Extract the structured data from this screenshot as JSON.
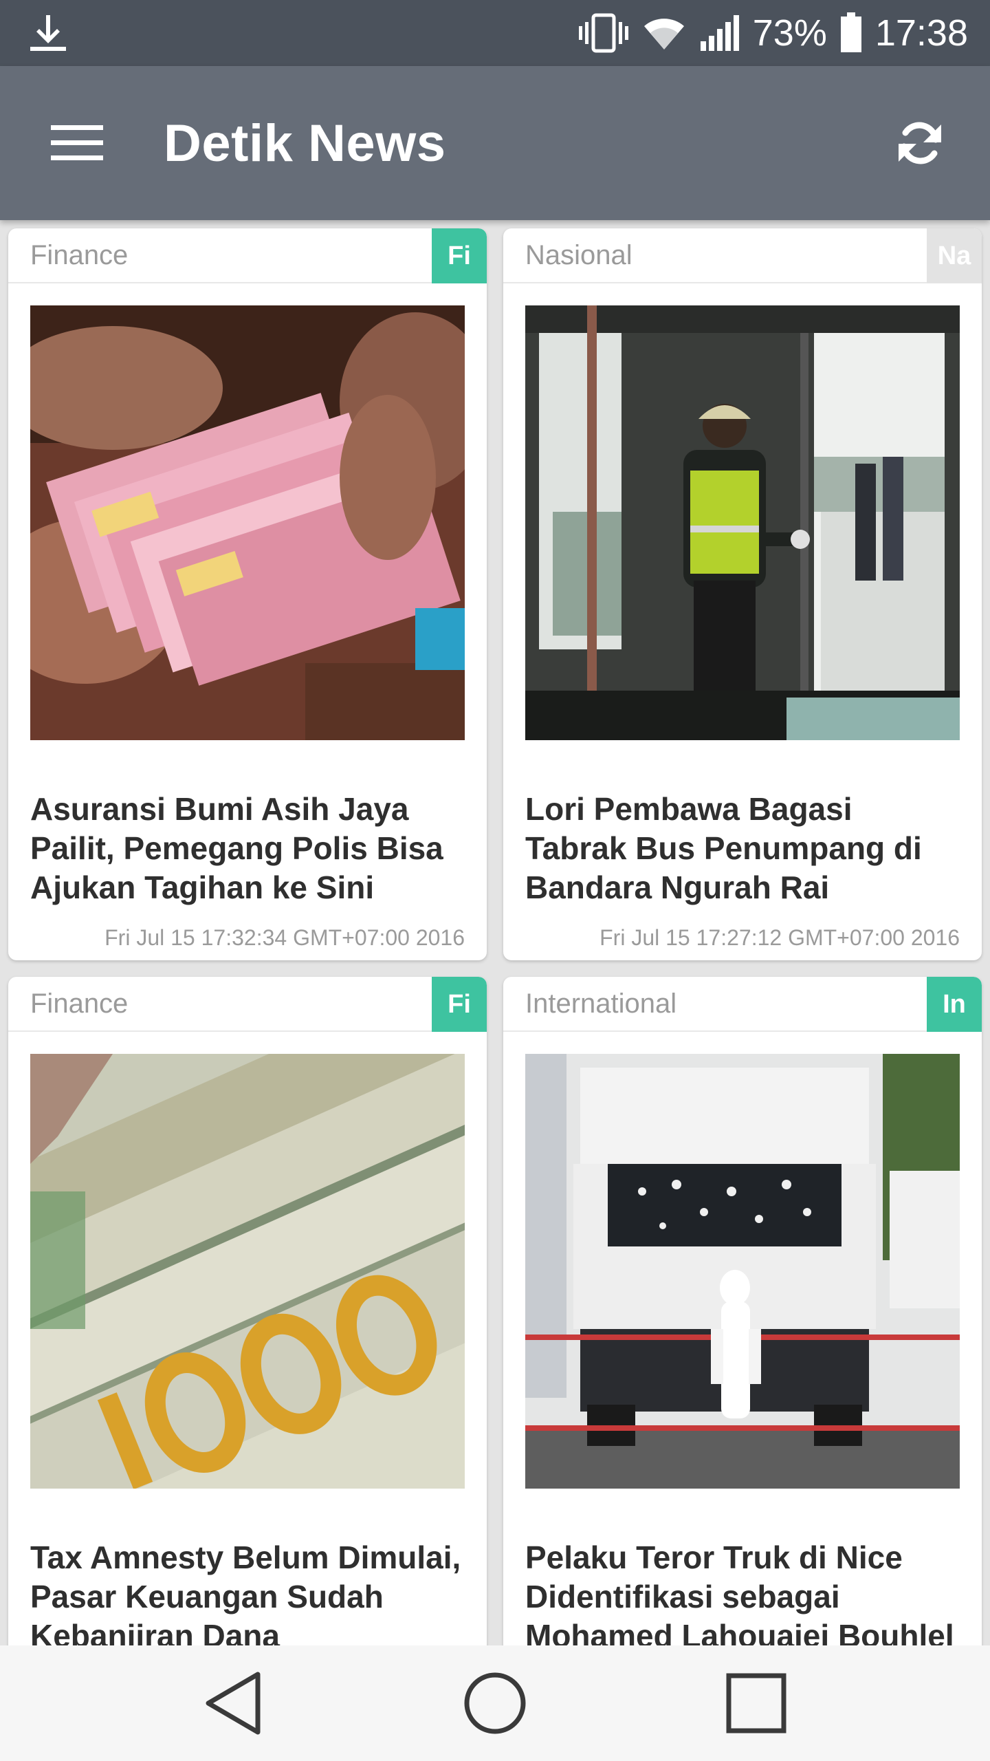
{
  "status_bar": {
    "battery_percent": "73%",
    "time": "17:38",
    "icons": [
      "download-icon",
      "vibrate-icon",
      "wifi-icon",
      "signal-icon",
      "battery-icon"
    ]
  },
  "toolbar": {
    "title": "Detik News",
    "menu_icon": "hamburger-menu-icon",
    "refresh_icon": "refresh-icon",
    "background": "#666d78"
  },
  "articles": [
    {
      "category": "Finance",
      "badge": "Fi",
      "badge_color": "#3ec3a0",
      "headline": "Asuransi Bumi Asih Jaya Pailit, Pemegang Polis Bisa Ajukan Tagihan ke Sini",
      "date": "Fri Jul 15 17:32:34 GMT+07:00 2016",
      "image": "rupiah-banknotes-photo"
    },
    {
      "category": "Nasional",
      "badge": "Na",
      "badge_color": "#e3e3e3",
      "headline": "Lori Pembawa Bagasi Tabrak Bus Penumpang di Bandara Ngurah Rai",
      "date": "Fri Jul 15 17:27:12 GMT+07:00 2016",
      "image": "airport-worker-photo"
    },
    {
      "category": "Finance",
      "badge": "Fi",
      "badge_color": "#3ec3a0",
      "headline": "Tax Amnesty Belum Dimulai, Pasar Keuangan Sudah Kebanjiran Dana",
      "date": "",
      "image": "dollar-banknotes-photo"
    },
    {
      "category": "International",
      "badge": "In",
      "badge_color": "#3ec3a0",
      "headline": "Pelaku Teror Truk di Nice Didentifikasi sebagai Mohamed Lahouaiej Bouhlel",
      "date": "",
      "image": "damaged-truck-photo"
    }
  ],
  "nav_bar": {
    "buttons": [
      "back-icon",
      "home-icon",
      "recents-icon"
    ]
  }
}
